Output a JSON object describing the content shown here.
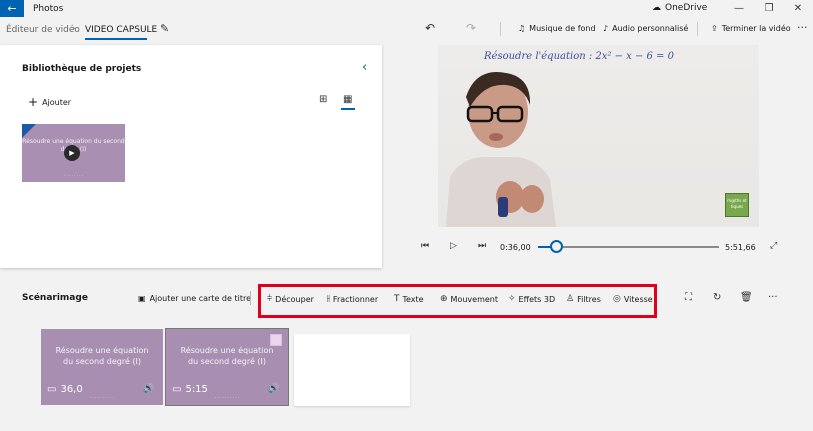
{
  "titlebar": {
    "app_title": "Photos",
    "onedrive": "OneDrive",
    "minimize": "—",
    "restore": "❐",
    "close": "✕"
  },
  "breadcrumb": {
    "parent": "Éditeur de vidéo",
    "separator": "›",
    "current": "VIDEO CAPSULE"
  },
  "toolbar": {
    "musique_de_fond": "Musique de fond",
    "audio_personnalise": "Audio personnalisé",
    "terminer": "Terminer la vidéo",
    "more": "···"
  },
  "library": {
    "title": "Bibliothèque de projets",
    "add_label": "Ajouter",
    "thumb_text": "Résoudre une équation du second degré (I)"
  },
  "preview": {
    "board_text": "Résoudre l'équation :  2x² − x − 6 = 0",
    "logo_text": "m@ths et tiques"
  },
  "playback": {
    "current_time": "0:36,00",
    "total_time": "5:51,66",
    "progress": 0.102
  },
  "storyboard": {
    "title": "Scénarimage",
    "add_title_card": "Ajouter une carte de titre",
    "tools": [
      {
        "icon": "⫩",
        "label": "Découper"
      },
      {
        "icon": "⫲",
        "label": "Fractionner"
      },
      {
        "icon": "T",
        "label": "Texte"
      },
      {
        "icon": "⊕",
        "label": "Mouvement"
      },
      {
        "icon": "✧",
        "label": "Effets 3D"
      },
      {
        "icon": "♙",
        "label": "Filtres"
      },
      {
        "icon": "◎",
        "label": "Vitesse"
      }
    ],
    "clips": [
      {
        "text_line1": "Résoudre une équation",
        "text_line2": "du second degré (I)",
        "duration": "36,0"
      },
      {
        "text_line1": "Résoudre une équation",
        "text_line2": "du second degré (I)",
        "duration": "5:15"
      }
    ]
  },
  "colors": {
    "accent": "#0063b1",
    "highlight_box": "#e0001b",
    "clip_bg": "#a88fb1"
  }
}
